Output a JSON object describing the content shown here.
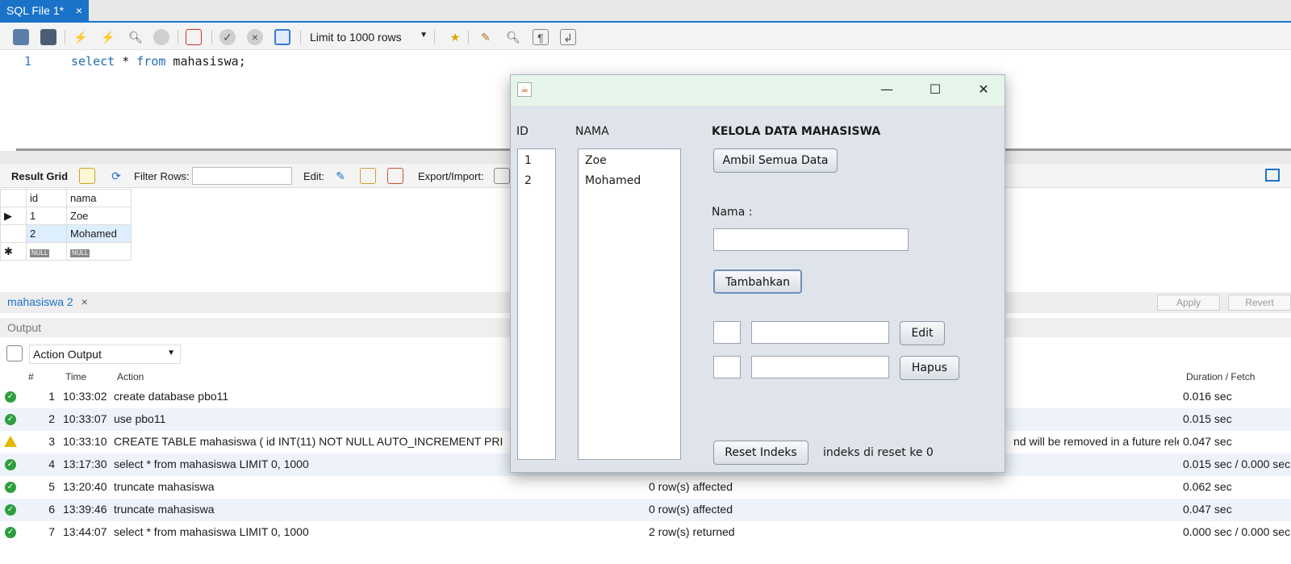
{
  "tab": {
    "title": "SQL File 1*",
    "close": "×"
  },
  "toolbar": {
    "limit_label": "Limit to 1000 rows"
  },
  "editor": {
    "line_no": "1",
    "kw1": "select",
    "mid": " * ",
    "kw2": "from",
    "rest": " mahasiswa;"
  },
  "result_toolbar": {
    "result_grid": "Result Grid",
    "filter_rows": "Filter Rows:",
    "edit": "Edit:",
    "export_import": "Export/Import:"
  },
  "grid": {
    "headers": [
      "id",
      "nama"
    ],
    "rows": [
      {
        "id": "1",
        "nama": "Zoe"
      },
      {
        "id": "2",
        "nama": "Mohamed"
      }
    ],
    "null": "NULL"
  },
  "result_tabs": {
    "tab": "mahasiswa 2",
    "close": "×",
    "apply": "Apply",
    "revert": "Revert"
  },
  "output": {
    "title": "Output",
    "selector": "Action Output",
    "headers": {
      "num": "#",
      "time": "Time",
      "action": "Action",
      "duration": "Duration / Fetch"
    },
    "rows": [
      {
        "num": "1",
        "time": "10:33:02",
        "action": "create database pbo11",
        "message": "",
        "duration": "0.016 sec",
        "status": "ok"
      },
      {
        "num": "2",
        "time": "10:33:07",
        "action": "use pbo11",
        "message": "",
        "duration": "0.015 sec",
        "status": "ok"
      },
      {
        "num": "3",
        "time": "10:33:10",
        "action": "CREATE TABLE mahasiswa (    id INT(11) NOT NULL AUTO_INCREMENT PRI",
        "message": "nd will be removed in a future rele...",
        "duration": "0.047 sec",
        "status": "warn"
      },
      {
        "num": "4",
        "time": "13:17:30",
        "action": "select * from mahasiswa LIMIT 0, 1000",
        "message": "",
        "duration": "0.015 sec / 0.000 sec",
        "status": "ok"
      },
      {
        "num": "5",
        "time": "13:20:40",
        "action": "truncate mahasiswa",
        "message": "0 row(s) affected",
        "duration": "0.062 sec",
        "status": "ok"
      },
      {
        "num": "6",
        "time": "13:39:46",
        "action": "truncate mahasiswa",
        "message": "0 row(s) affected",
        "duration": "0.047 sec",
        "status": "ok"
      },
      {
        "num": "7",
        "time": "13:44:07",
        "action": "select * from mahasiswa LIMIT 0, 1000",
        "message": "2 row(s) returned",
        "duration": "0.000 sec / 0.000 sec",
        "status": "ok"
      }
    ]
  },
  "dialog": {
    "id_label": "ID",
    "nama_label": "NAMA",
    "heading": "KELOLA DATA MAHASISWA",
    "ambil_button": "Ambil Semua Data",
    "nama_field_label": "Nama :",
    "tambah_button": "Tambahkan",
    "edit_button": "Edit",
    "hapus_button": "Hapus",
    "reset_button": "Reset Indeks",
    "status": "indeks di reset ke 0",
    "ids": [
      "1",
      "2"
    ],
    "names": [
      "Zoe",
      "Mohamed"
    ]
  }
}
